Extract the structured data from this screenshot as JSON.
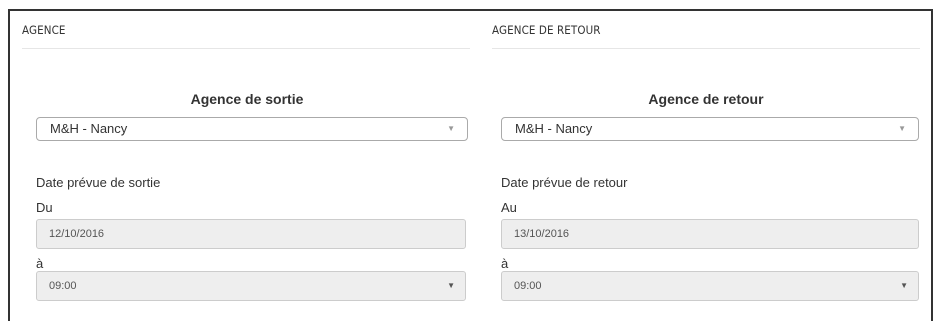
{
  "agence": {
    "header": "AGENCE",
    "title": "Agence de sortie",
    "agency_value": "M&H - Nancy",
    "date_label": "Date prévue de sortie",
    "from_label": "Du",
    "date_value": "12/10/2016",
    "time_label": "à",
    "time_value": "09:00"
  },
  "retour": {
    "header": "AGENCE DE RETOUR",
    "title": "Agence de retour",
    "agency_value": "M&H - Nancy",
    "date_label": "Date prévue de retour",
    "from_label": "Au",
    "date_value": "13/10/2016",
    "time_label": "à",
    "time_value": "09:00"
  },
  "icons": {
    "select_arrow": "chevron-down-icon"
  }
}
